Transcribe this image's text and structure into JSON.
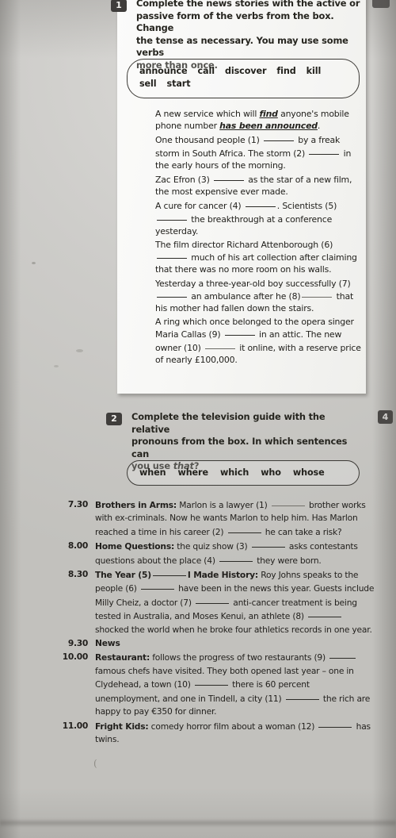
{
  "page": {
    "side_marker": "4"
  },
  "exercise1": {
    "number": "1",
    "instruction_line1": "Complete the news stories with the active or",
    "instruction_line2": "passive form of the verbs from the box. Change",
    "instruction_line3": "the tense as necessary. You may use some verbs",
    "instruction_line4": "more than once.",
    "wordbox": [
      "announce",
      "call",
      "discover",
      "find",
      "kill",
      "sell",
      "start"
    ],
    "items": [
      {
        "id": "example",
        "parts": [
          {
            "t": "A new service which will "
          },
          {
            "t": "find",
            "style": "answer"
          },
          {
            "t": " anyone's mobile phone number "
          },
          {
            "t": "has been announced",
            "style": "answer"
          },
          {
            "t": "."
          }
        ]
      },
      {
        "id": "1-2",
        "parts": [
          {
            "t": "One thousand people (1) "
          },
          {
            "t": "",
            "style": "gap"
          },
          {
            "t": " by a freak storm in South Africa. The storm (2) "
          },
          {
            "t": "",
            "style": "gap"
          },
          {
            "t": " in the early hours of the morning."
          }
        ]
      },
      {
        "id": "3",
        "parts": [
          {
            "t": "Zac Efron (3) "
          },
          {
            "t": "",
            "style": "gap"
          },
          {
            "t": " as the star of a new film, the most expensive ever made."
          }
        ]
      },
      {
        "id": "4-5",
        "parts": [
          {
            "t": "A cure for cancer (4) "
          },
          {
            "t": "",
            "style": "gap"
          },
          {
            "t": ". Scientists (5) "
          },
          {
            "t": "",
            "style": "gap"
          },
          {
            "t": " the breakthrough at a conference yesterday."
          }
        ]
      },
      {
        "id": "6",
        "parts": [
          {
            "t": "The film director Richard Attenborough (6) "
          },
          {
            "t": "",
            "style": "gap"
          },
          {
            "t": " much of his art collection after claiming that there was no more room on his walls."
          }
        ]
      },
      {
        "id": "7-8",
        "parts": [
          {
            "t": "Yesterday a three-year-old boy successfully (7) "
          },
          {
            "t": "",
            "style": "gap"
          },
          {
            "t": " an ambulance after he (8)"
          },
          {
            "t": "",
            "style": "gap-faint"
          },
          {
            "t": " that his mother had fallen down the stairs."
          }
        ]
      },
      {
        "id": "9-10",
        "parts": [
          {
            "t": "A ring which once belonged to the opera singer Maria Callas (9) "
          },
          {
            "t": "",
            "style": "gap"
          },
          {
            "t": " in an attic. The new owner (10) "
          },
          {
            "t": "",
            "style": "gap-faint"
          },
          {
            "t": " it online, with a reserve price of nearly £100,000."
          }
        ]
      }
    ]
  },
  "exercise2": {
    "number": "2",
    "instruction_line1": "Complete the television guide with the relative",
    "instruction_line2": "pronouns from the box. In which sentences can",
    "instruction_line3_pre": "you use ",
    "instruction_line3_italic": "that",
    "instruction_line3_post": "?",
    "wordbox": [
      "when",
      "where",
      "which",
      "who",
      "whose"
    ],
    "listings": [
      {
        "time": "7.30",
        "parts": [
          {
            "t": "Brothers in Arms:",
            "style": "title"
          },
          {
            "t": " Marlon is a lawyer (1) "
          },
          {
            "t": "",
            "style": "gap-faint"
          },
          {
            "t": " brother works with ex-criminals. Now he wants Marlon to help him. Has Marlon reached a time in his career (2) "
          },
          {
            "t": "",
            "style": "gap"
          },
          {
            "t": " he can take a risk?"
          }
        ]
      },
      {
        "time": "8.00",
        "parts": [
          {
            "t": "Home Questions:",
            "style": "title"
          },
          {
            "t": " the quiz show (3) "
          },
          {
            "t": "",
            "style": "gap"
          },
          {
            "t": " asks contestants questions about the place (4) "
          },
          {
            "t": "",
            "style": "gap"
          },
          {
            "t": " they were born."
          }
        ]
      },
      {
        "time": "8.30",
        "parts": [
          {
            "t": "The Year (5)",
            "style": "title"
          },
          {
            "t": "",
            "style": "gap"
          },
          {
            "t": "I Made History:",
            "style": "title"
          },
          {
            "t": " Roy Johns speaks to the people (6) "
          },
          {
            "t": "",
            "style": "gap"
          },
          {
            "t": " have been in the news this year. Guests include Milly Cheiz, a doctor (7) "
          },
          {
            "t": "",
            "style": "gap"
          },
          {
            "t": " anti-cancer treatment is being tested in Australia, and Moses Kenui, an athlete (8) "
          },
          {
            "t": "",
            "style": "gap"
          },
          {
            "t": " shocked the world when he broke four athletics records in one year."
          }
        ]
      },
      {
        "time": "9.30",
        "parts": [
          {
            "t": "News",
            "style": "title"
          }
        ]
      },
      {
        "time": "10.00",
        "parts": [
          {
            "t": "Restaurant:",
            "style": "title"
          },
          {
            "t": " follows the progress of two restaurants (9) "
          },
          {
            "t": "",
            "style": "gap-short"
          },
          {
            "t": " famous chefs have visited. They both opened last year – one in Clydehead, a town (10) "
          },
          {
            "t": "",
            "style": "gap"
          },
          {
            "t": " there is 60 percent unemployment, and one in Tindell, a city (11) "
          },
          {
            "t": "",
            "style": "gap"
          },
          {
            "t": " the rich are happy to pay €350 for dinner."
          }
        ]
      },
      {
        "time": "11.00",
        "parts": [
          {
            "t": "Fright Kids:",
            "style": "title"
          },
          {
            "t": " comedy horror film about a woman (12) "
          },
          {
            "t": "",
            "style": "gap"
          },
          {
            "t": " has twins."
          }
        ]
      }
    ]
  }
}
